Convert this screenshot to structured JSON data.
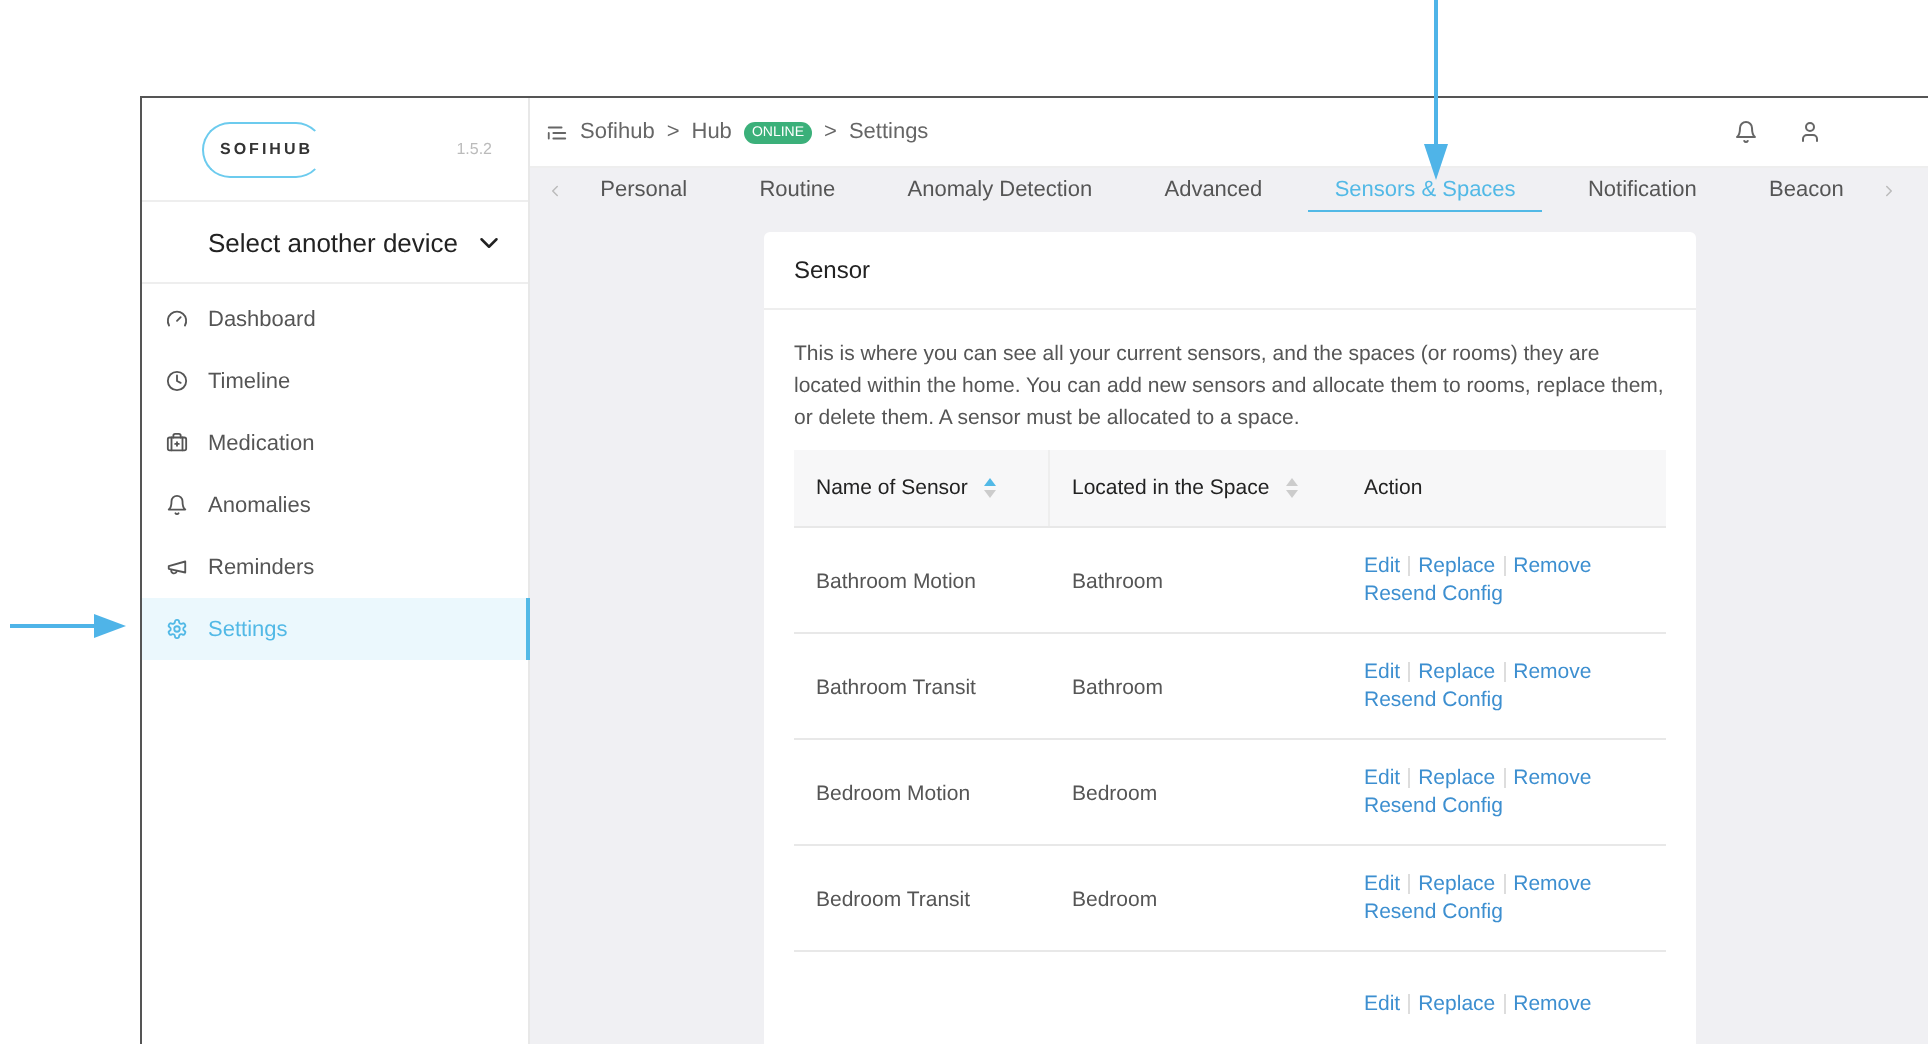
{
  "sidebar": {
    "logo": "SOFIHUB",
    "version": "1.5.2",
    "device_select": "Select another device",
    "items": [
      {
        "label": "Dashboard",
        "selected": false
      },
      {
        "label": "Timeline",
        "selected": false
      },
      {
        "label": "Medication",
        "selected": false
      },
      {
        "label": "Anomalies",
        "selected": false
      },
      {
        "label": "Reminders",
        "selected": false
      },
      {
        "label": "Settings",
        "selected": true
      }
    ]
  },
  "breadcrumb": {
    "items": [
      "Sofihub",
      ">",
      "Hub",
      ">",
      "Settings"
    ],
    "badge": "ONLINE"
  },
  "tabs": [
    {
      "label": "Personal",
      "selected": false
    },
    {
      "label": "Routine",
      "selected": false
    },
    {
      "label": "Anomaly Detection",
      "selected": false
    },
    {
      "label": "Advanced",
      "selected": false
    },
    {
      "label": "Sensors & Spaces",
      "selected": true
    },
    {
      "label": "Notification",
      "selected": false
    },
    {
      "label": "Beacon",
      "selected": false
    }
  ],
  "card": {
    "title": "Sensor",
    "description": "This is where you can see all your current sensors, and the spaces (or rooms) they are located within the home. You can add new sensors and allocate them to rooms, replace them, or delete them. A sensor must be allocated to a space.",
    "columns": [
      {
        "label": "Name of Sensor",
        "sortable": true,
        "sorted": true
      },
      {
        "label": "Located in the Space",
        "sortable": true,
        "sorted": false
      },
      {
        "label": "Action",
        "sortable": false
      }
    ],
    "rows": [
      {
        "name": "Bathroom Motion",
        "space": "Bathroom",
        "actions": [
          "Edit",
          "Replace",
          "Remove"
        ],
        "extra": "Resend Config"
      },
      {
        "name": "Bathroom Transit",
        "space": "Bathroom",
        "actions": [
          "Edit",
          "Replace",
          "Remove"
        ],
        "extra": "Resend Config"
      },
      {
        "name": "Bedroom Motion",
        "space": "Bedroom",
        "actions": [
          "Edit",
          "Replace",
          "Remove"
        ],
        "extra": "Resend Config"
      },
      {
        "name": "Bedroom Transit",
        "space": "Bedroom",
        "actions": [
          "Edit",
          "Replace",
          "Remove"
        ],
        "extra": "Resend Config"
      },
      {
        "actions": [
          "Edit",
          "Replace",
          "Remove"
        ]
      }
    ]
  }
}
